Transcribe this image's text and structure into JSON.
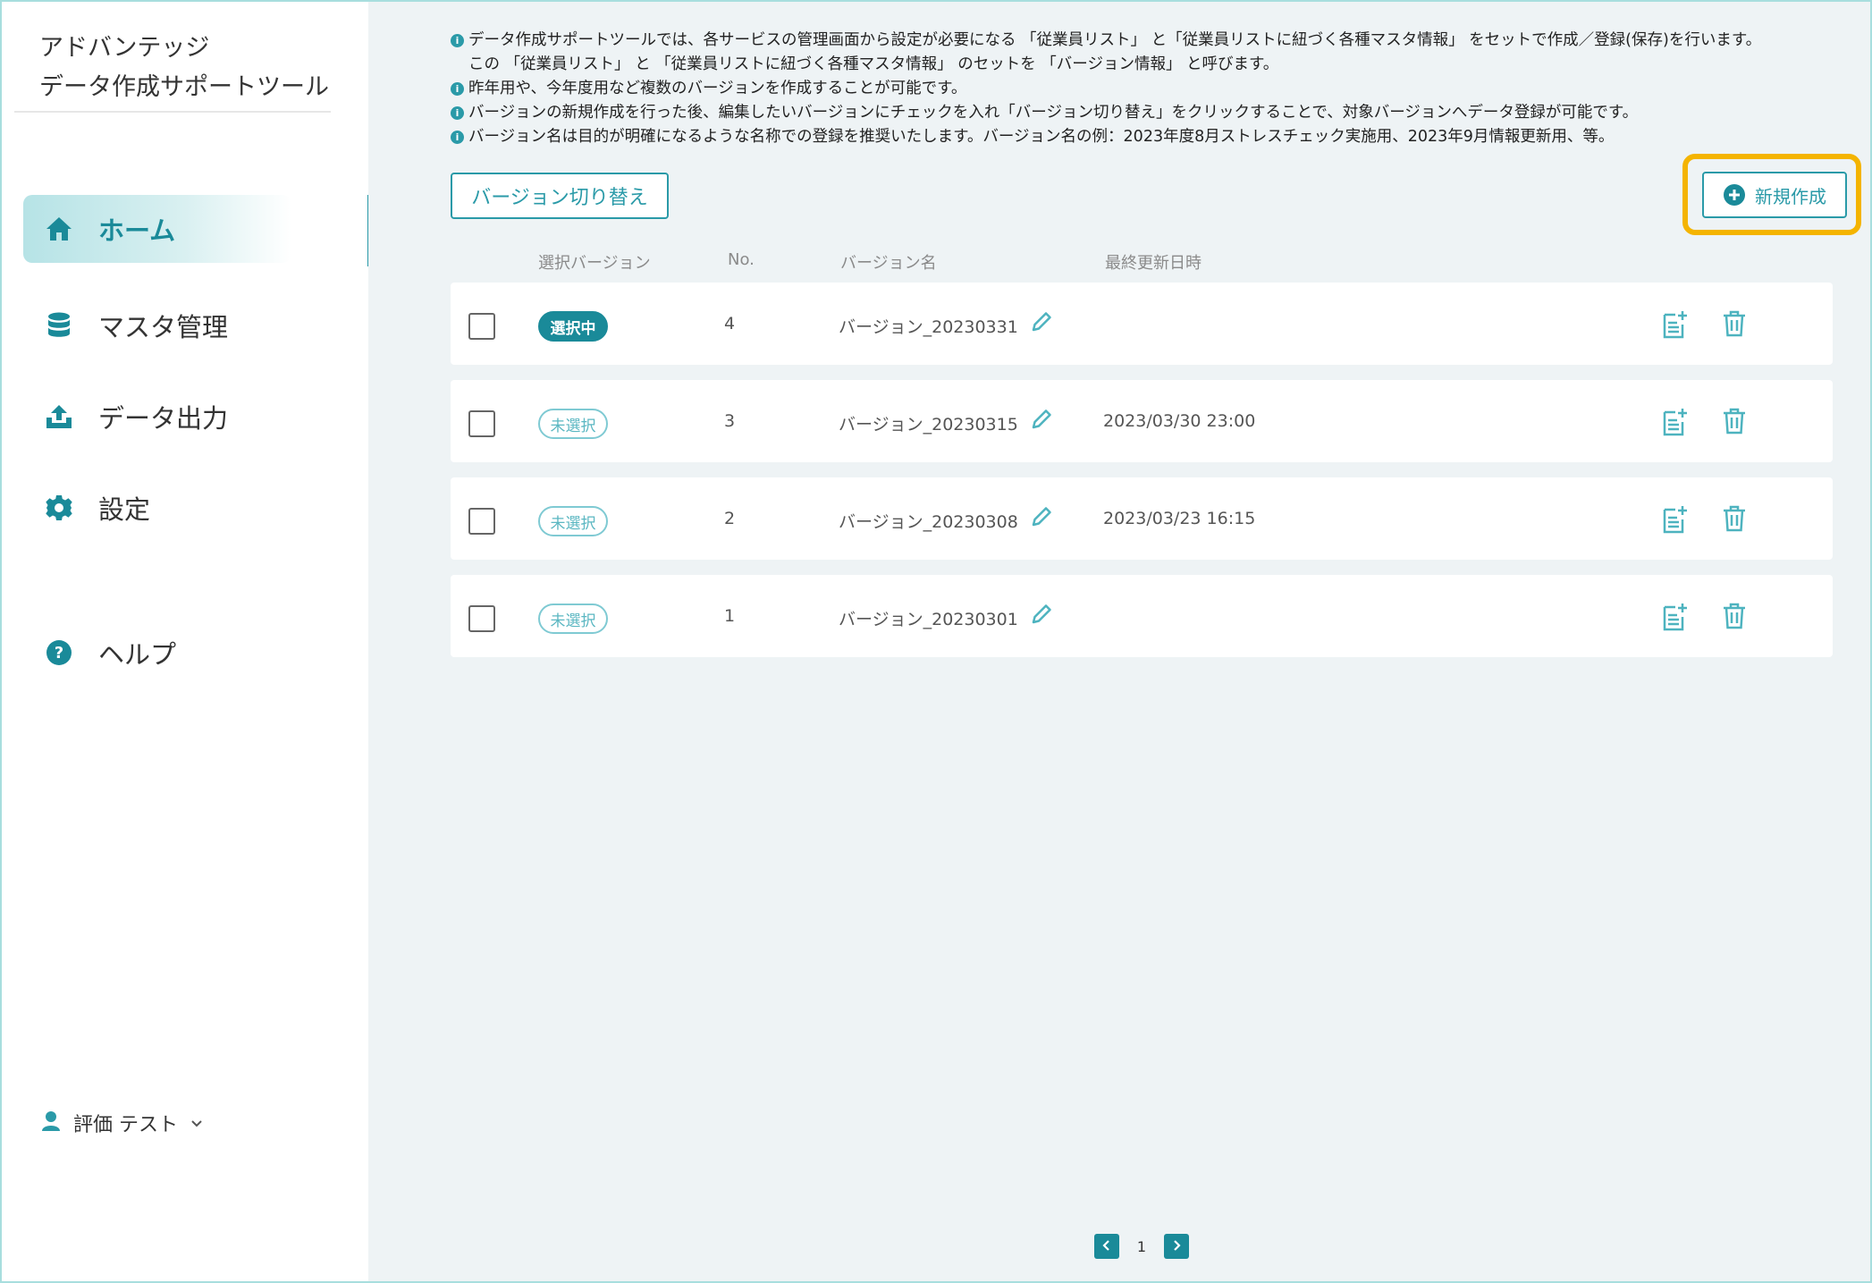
{
  "app": {
    "title_line1": "アドバンテッジ",
    "title_line2": "データ作成サポートツール"
  },
  "sidebar": {
    "items": [
      {
        "label": "ホーム",
        "icon": "home-icon",
        "active": true
      },
      {
        "label": "マスタ管理",
        "icon": "database-icon",
        "active": false
      },
      {
        "label": "データ出力",
        "icon": "upload-icon",
        "active": false
      },
      {
        "label": "設定",
        "icon": "gear-icon",
        "active": false
      },
      {
        "label": "ヘルプ",
        "icon": "help-icon",
        "active": false
      }
    ],
    "user": {
      "name": "評価 テスト",
      "icon": "user-icon"
    }
  },
  "notes": [
    "データ作成サポートツールでは、各サービスの管理画面から設定が必要になる 「従業員リスト」 と「従業員リストに紐づく各種マスタ情報」 をセットで作成／登録(保存)を行います。",
    "この 「従業員リスト」 と 「従業員リストに紐づく各種マスタ情報」 のセットを 「バージョン情報」 と呼びます。",
    "昨年用や、今年度用など複数のバージョンを作成することが可能です。",
    "バージョンの新規作成を行った後、編集したいバージョンにチェックを入れ「バージョン切り替え」をクリックすることで、対象バージョンへデータ登録が可能です。",
    "バージョン名は目的が明確になるような名称での登録を推奨いたします。バージョン名の例：2023年度8月ストレスチェック実施用、2023年9月情報更新用、等。"
  ],
  "toolbar": {
    "switch_label": "バージョン切り替え",
    "new_label": "新規作成"
  },
  "table": {
    "headers": {
      "selected": "選択バージョン",
      "no": "No.",
      "name": "バージョン名",
      "updated": "最終更新日時"
    },
    "rows": [
      {
        "status": "選択中",
        "selected": true,
        "no": "4",
        "name": "バージョン_20230331",
        "updated": ""
      },
      {
        "status": "未選択",
        "selected": false,
        "no": "3",
        "name": "バージョン_20230315",
        "updated": "2023/03/30 23:00"
      },
      {
        "status": "未選択",
        "selected": false,
        "no": "2",
        "name": "バージョン_20230308",
        "updated": "2023/03/23 16:15"
      },
      {
        "status": "未選択",
        "selected": false,
        "no": "1",
        "name": "バージョン_20230301",
        "updated": ""
      }
    ]
  },
  "pagination": {
    "current": "1"
  },
  "colors": {
    "accent": "#2a9aa8",
    "accent_dark": "#1a8a99",
    "highlight": "#f4b400",
    "main_bg": "#eef3f5"
  }
}
